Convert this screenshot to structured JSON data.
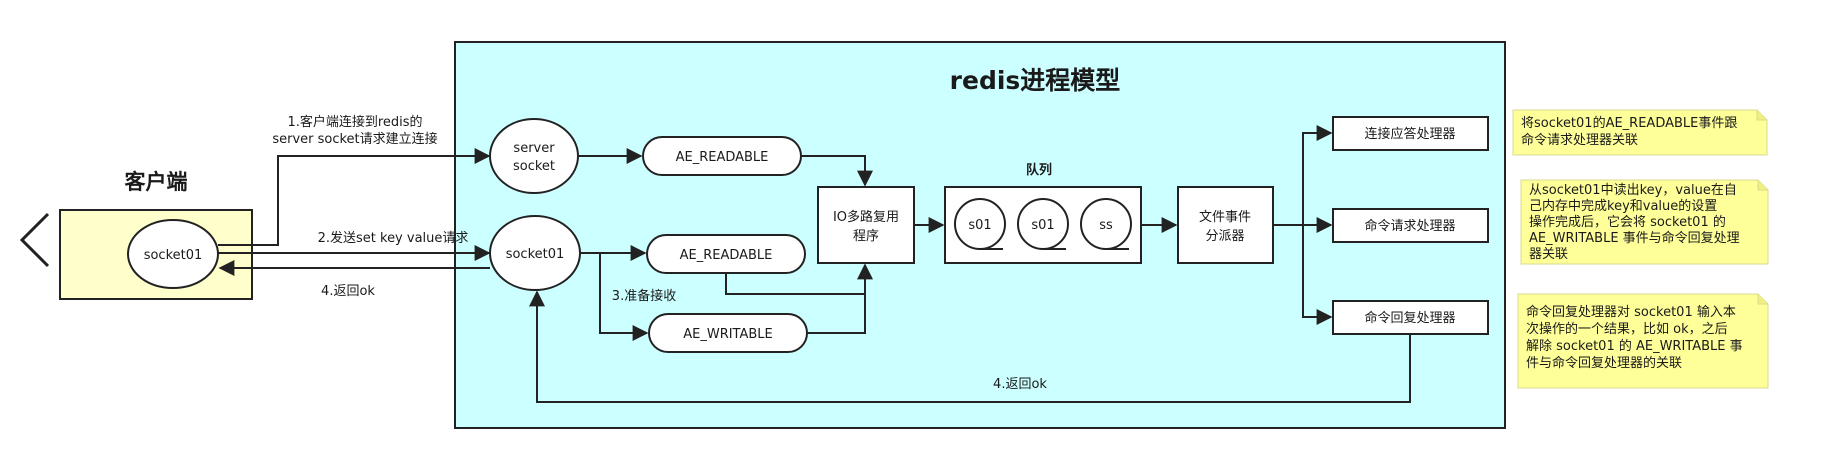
{
  "title": "redis进程模型",
  "client": {
    "title": "客户端",
    "socket_label": "socket01"
  },
  "nodes": {
    "server_socket_line1": "server",
    "server_socket_line2": "socket",
    "socket01": "socket01",
    "ae_readable_1": "AE_READABLE",
    "ae_readable_2": "AE_READABLE",
    "ae_writable": "AE_WRITABLE",
    "io_mux_line1": "IO多路复用",
    "io_mux_line2": "程序",
    "queue_title": "队列",
    "queue_items": [
      "s01",
      "s01",
      "ss"
    ],
    "dispatcher_line1": "文件事件",
    "dispatcher_line2": "分派器",
    "handler_connect": "连接应答处理器",
    "handler_request": "命令请求处理器",
    "handler_reply": "命令回复处理器"
  },
  "edges": {
    "step1_line1": "1.客户端连接到redis的",
    "step1_line2": "server socket请求建立连接",
    "step2": "2.发送set key value请求",
    "step3": "3.准备接收",
    "step4_client": "4.返回ok",
    "step4_bottom": "4.返回ok"
  },
  "notes": [
    {
      "lines": [
        "将socket01的AE_READABLE事件跟",
        "命令请求处理器关联"
      ]
    },
    {
      "lines": [
        "从socket01中读出key，value在自",
        "己内存中完成key和value的设置",
        "操作完成后，它会将 socket01 的",
        "AE_WRITABLE 事件与命令回复处理",
        "器关联"
      ]
    },
    {
      "lines": [
        "命令回复处理器对 socket01 输入本",
        "次操作的一个结果，比如 ok，之后",
        "解除 socket01 的 AE_WRITABLE 事",
        "件与命令回复处理器的关联"
      ]
    }
  ],
  "colors": {
    "process_bg": "#ccffff",
    "client_bg": "#ffffcc",
    "note_bg": "#ffff99",
    "note_border": "#d8d890",
    "line": "#222222"
  }
}
